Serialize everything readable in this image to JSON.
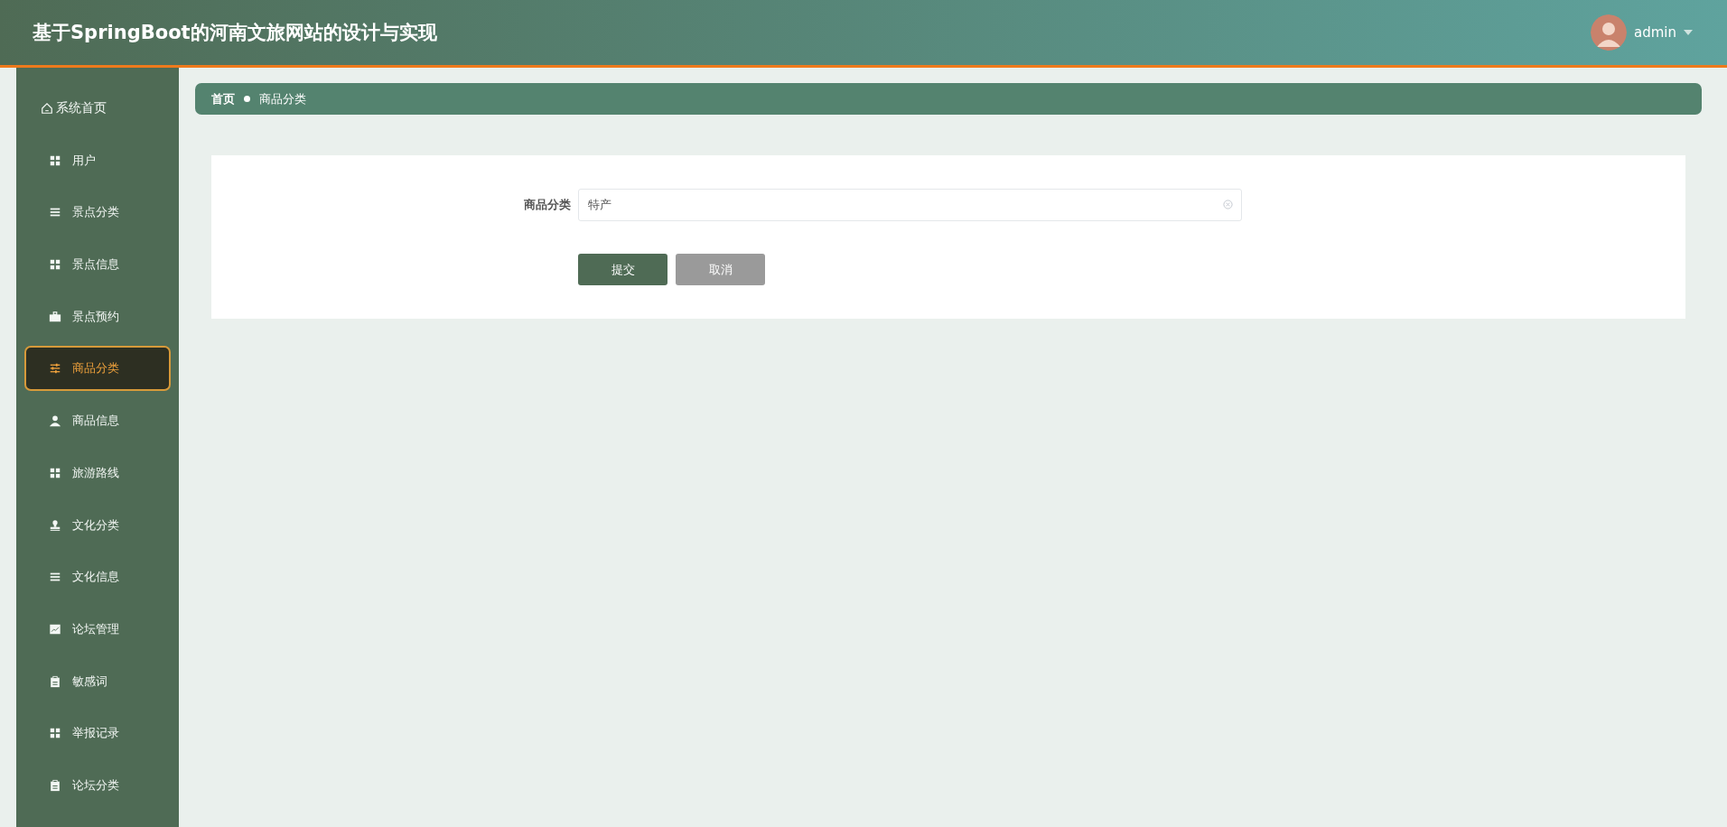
{
  "header": {
    "title": "基于SpringBoot的河南文旅网站的设计与实现",
    "user": {
      "name": "admin"
    }
  },
  "sidebar": {
    "items": [
      {
        "label": "系统首页",
        "kind": "home",
        "selected": false
      },
      {
        "label": "用户",
        "kind": "grid",
        "selected": false
      },
      {
        "label": "景点分类",
        "kind": "list",
        "selected": false
      },
      {
        "label": "景点信息",
        "kind": "grid",
        "selected": false
      },
      {
        "label": "景点预约",
        "kind": "briefcase",
        "selected": false
      },
      {
        "label": "商品分类",
        "kind": "sliders",
        "selected": true
      },
      {
        "label": "商品信息",
        "kind": "person",
        "selected": false
      },
      {
        "label": "旅游路线",
        "kind": "grid",
        "selected": false
      },
      {
        "label": "文化分类",
        "kind": "stamp",
        "selected": false
      },
      {
        "label": "文化信息",
        "kind": "list",
        "selected": false
      },
      {
        "label": "论坛管理",
        "kind": "chart",
        "selected": false
      },
      {
        "label": "敏感词",
        "kind": "clipboard",
        "selected": false
      },
      {
        "label": "举报记录",
        "kind": "grid",
        "selected": false
      },
      {
        "label": "论坛分类",
        "kind": "clipboard",
        "selected": false
      }
    ]
  },
  "breadcrumb": [
    "首页",
    "商品分类"
  ],
  "form": {
    "fields": [
      {
        "label": "商品分类",
        "value": "特产"
      }
    ],
    "buttons": [
      {
        "label": "提交",
        "kind": "primary"
      },
      {
        "label": "取消",
        "kind": "secondary"
      }
    ]
  }
}
